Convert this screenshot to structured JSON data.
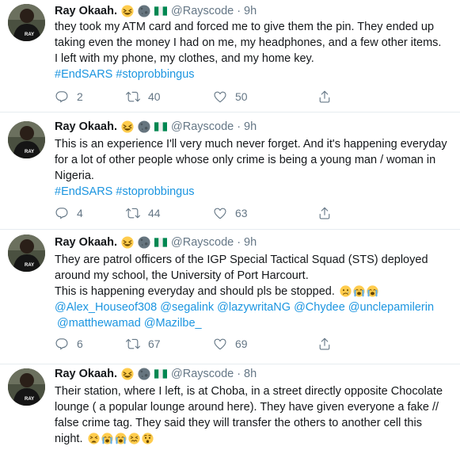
{
  "author": {
    "name": "Ray Okaah.",
    "handle": "@Rayscode",
    "separator": "·"
  },
  "tweets": [
    {
      "time": "9h",
      "lines": [
        "they took my ATM card and forced me to give them the pin. They ended up",
        "taking even the money I had on me, my headphones, and a few other items.",
        "I left with my phone, my clothes, and my home key."
      ],
      "hashtags": "#EndSARS #stoprobbingus",
      "reply_count": "2",
      "retweet_count": "40",
      "like_count": "50"
    },
    {
      "time": "9h",
      "lines": [
        "This is an experience I'll very much never forget. And it's happening everyday",
        "for a lot of other people whose only crime is being a young man / woman in",
        "Nigeria."
      ],
      "hashtags": "#EndSARS #stoprobbingus",
      "reply_count": "4",
      "retweet_count": "44",
      "like_count": "63"
    },
    {
      "time": "9h",
      "lines": [
        "They are patrol officers of the IGP Special Tactical Squad (STS) deployed",
        "around my school, the University of Port Harcourt.",
        "This is happening everyday and should pls be stopped."
      ],
      "mentions_line1": "@Alex_Houseof308 @segalink @lazywritaNG @Chydee @unclepamilerin",
      "mentions_line2": "@matthewamad @Mazilbe_",
      "reply_count": "6",
      "retweet_count": "67",
      "like_count": "69"
    },
    {
      "time": "8h",
      "lines": [
        "Their station, where I left, is at Choba, in a street directly opposite Chocolate",
        "lounge ( a popular lounge around here). They have given everyone a fake //",
        "false crime tag. They said they will transfer the others to another cell this",
        "night."
      ]
    }
  ],
  "icons": {
    "name_emojis": [
      "grinning-squinting-face",
      "new-moon-face",
      "nigeria-flag"
    ],
    "actions": [
      "reply-icon",
      "retweet-icon",
      "like-icon",
      "share-icon"
    ]
  },
  "colors": {
    "link": "#1b95e0",
    "muted": "#657786",
    "text": "#14171a",
    "divider": "#e6ecf0"
  }
}
